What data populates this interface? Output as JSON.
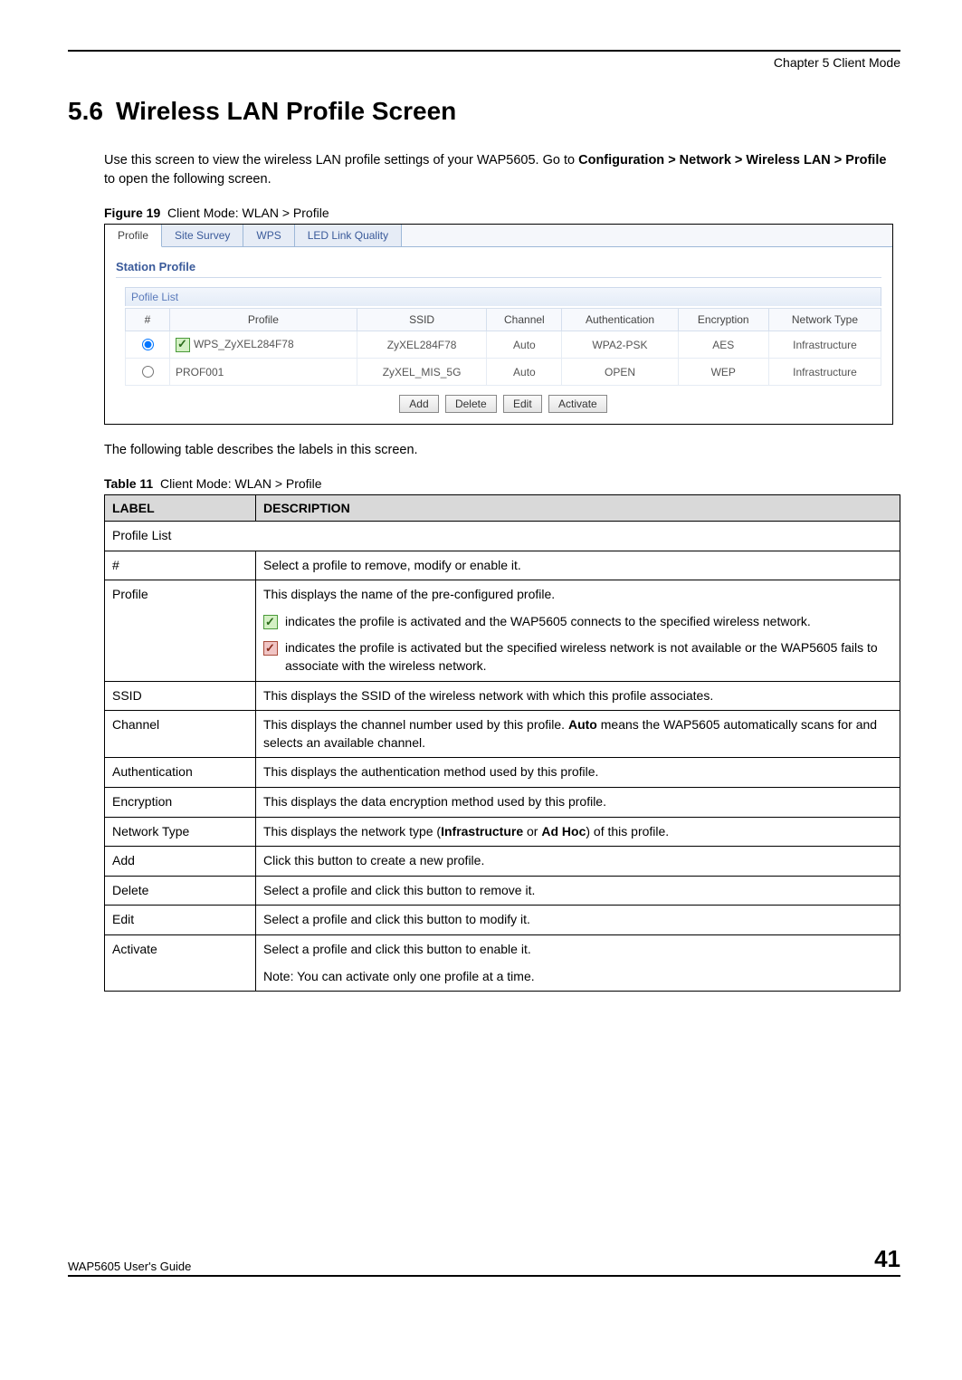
{
  "header": {
    "chapter": "Chapter 5 Client Mode"
  },
  "section": {
    "number": "5.6",
    "title": "Wireless LAN Profile Screen"
  },
  "intro": {
    "p1a": "Use this screen to view the wireless LAN profile settings of your WAP5605. Go to ",
    "p1b": "Configuration > Network > Wireless LAN > Profile",
    "p1c": " to open the following screen."
  },
  "figure": {
    "label": "Figure 19",
    "caption": "Client Mode: WLAN > Profile"
  },
  "ui": {
    "tabs": [
      "Profile",
      "Site Survey",
      "WPS",
      "LED Link Quality"
    ],
    "station_title": "Station Profile",
    "pofile_title": "Pofile List",
    "cols": {
      "num": "#",
      "profile": "Profile",
      "ssid": "SSID",
      "channel": "Channel",
      "auth": "Authentication",
      "enc": "Encryption",
      "ntype": "Network Type"
    },
    "rows": [
      {
        "selected": true,
        "active_icon": "green",
        "profile": "WPS_ZyXEL284F78",
        "ssid": "ZyXEL284F78",
        "channel": "Auto",
        "auth": "WPA2-PSK",
        "enc": "AES",
        "ntype": "Infrastructure"
      },
      {
        "selected": false,
        "active_icon": "",
        "profile": "PROF001",
        "ssid": "ZyXEL_MIS_5G",
        "channel": "Auto",
        "auth": "OPEN",
        "enc": "WEP",
        "ntype": "Infrastructure"
      }
    ],
    "buttons": {
      "add": "Add",
      "delete": "Delete",
      "edit": "Edit",
      "activate": "Activate"
    }
  },
  "after_fig": "The following table describes the labels in this screen.",
  "table": {
    "label": "Table 11",
    "caption": "Client Mode: WLAN > Profile",
    "head": {
      "label": "LABEL",
      "desc": "DESCRIPTION"
    },
    "rows": {
      "profileList": {
        "label": "Profile List",
        "desc": ""
      },
      "num": {
        "label": "#",
        "desc": "Select a profile to remove, modify or enable it."
      },
      "profile": {
        "label": "Profile",
        "line1": "This displays the name of the pre-configured profile.",
        "green": " indicates the profile is activated and the WAP5605 connects to the specified wireless network.",
        "red": " indicates the profile is activated but the specified wireless network is not available or the WAP5605 fails to associate with the wireless network."
      },
      "ssid": {
        "label": "SSID",
        "desc": "This displays the SSID of the wireless network with which this profile associates."
      },
      "channel": {
        "label": "Channel",
        "d1": "This displays the channel number used by this profile. ",
        "d2": "Auto",
        "d3": " means the WAP5605 automatically scans for and selects an available channel."
      },
      "auth": {
        "label": "Authentication",
        "desc": "This displays the authentication method used by this profile."
      },
      "enc": {
        "label": "Encryption",
        "desc": "This displays the data encryption method used by this profile."
      },
      "ntype": {
        "label": "Network Type",
        "d1": "This displays the network type (",
        "d2": "Infrastructure",
        "d3": " or ",
        "d4": "Ad Hoc",
        "d5": ") of this profile."
      },
      "add": {
        "label": "Add",
        "desc": "Click this button to create a new profile."
      },
      "delete": {
        "label": "Delete",
        "desc": "Select a profile and click this button to remove it."
      },
      "edit": {
        "label": "Edit",
        "desc": "Select a profile and click this button to modify it."
      },
      "activate": {
        "label": "Activate",
        "d1": "Select a profile and click this button to enable it.",
        "d2": "Note: You can activate only one profile at a time."
      }
    }
  },
  "footer": {
    "guide": "WAP5605 User's Guide",
    "page": "41"
  }
}
